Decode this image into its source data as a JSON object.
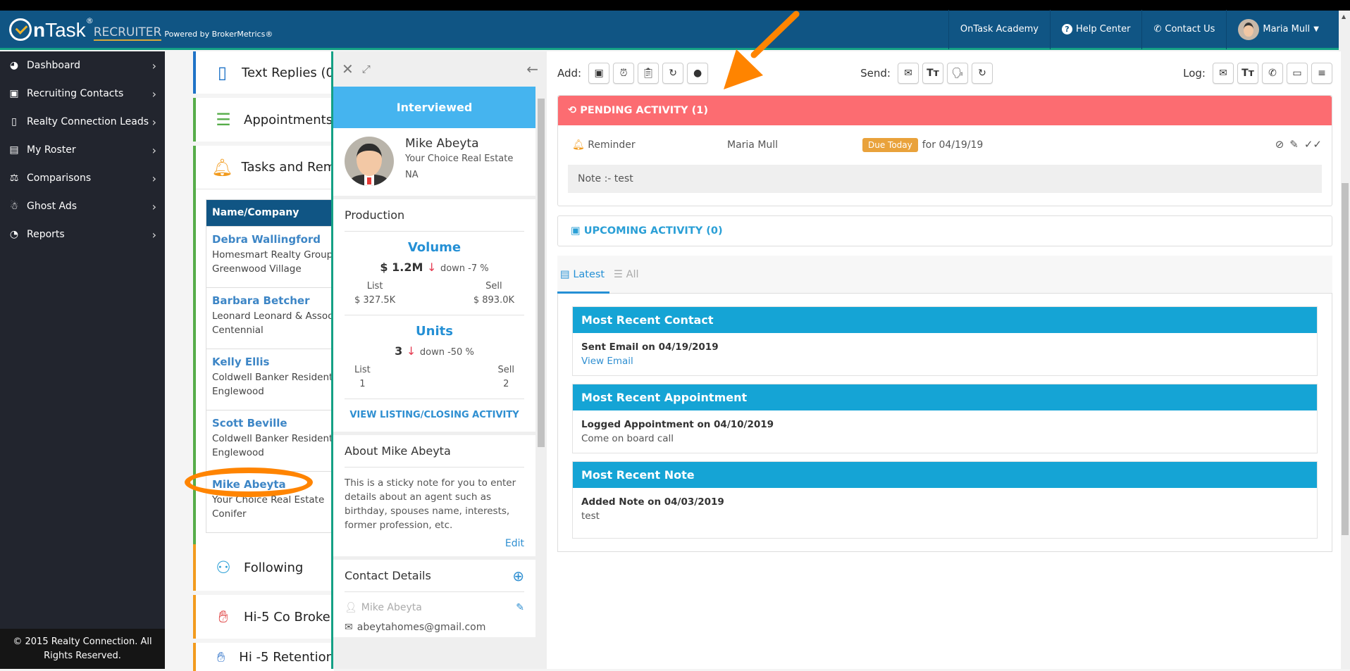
{
  "header": {
    "logo_on": "On",
    "logo_task": "Task",
    "logo_reg": "®",
    "logo_recruiter": "RECRUITER",
    "logo_powered": "Powered by BrokerMetrics®",
    "nav": [
      {
        "label": "OnTask Academy",
        "icon": ""
      },
      {
        "label": "Help Center",
        "icon": "question-circle"
      },
      {
        "label": "Contact Us",
        "icon": "phone"
      }
    ],
    "user": {
      "name": "Maria Mull",
      "icon": "chevron-down"
    }
  },
  "sidebar": {
    "items": [
      {
        "label": "Dashboard",
        "icon": "dashboard-gauge"
      },
      {
        "label": "Recruiting Contacts",
        "icon": "contact-card"
      },
      {
        "label": "Realty Connection Leads",
        "icon": "door"
      },
      {
        "label": "My Roster",
        "icon": "folder-network"
      },
      {
        "label": "Comparisons",
        "icon": "seesaw"
      },
      {
        "label": "Ghost Ads",
        "icon": "ghost"
      },
      {
        "label": "Reports",
        "icon": "pie-chart"
      }
    ],
    "footer": "© 2015 Realty Connection. All Rights Reserved."
  },
  "widgets": {
    "text_replies": "Text Replies (0",
    "appointments": "Appointments",
    "tasks": "Tasks and Rem",
    "table_header": "Name/Company",
    "rows": [
      {
        "name": "Debra Wallingford",
        "company": "Homesmart Realty Group",
        "city": "Greenwood Village"
      },
      {
        "name": "Barbara Betcher",
        "company": "Leonard Leonard & Assoc",
        "city": "Centennial"
      },
      {
        "name": "Kelly Ellis",
        "company": "Coldwell Banker Resident",
        "city": "Englewood"
      },
      {
        "name": "Scott Beville",
        "company": "Coldwell Banker Resident",
        "city": "Englewood"
      },
      {
        "name": "Mike Abeyta",
        "company": "Your Choice Real Estate",
        "city": "Conifer"
      }
    ],
    "following": "Following",
    "hi5_cobroke": "Hi-5 Co Broke",
    "hi5_retention": "Hi -5 Retention"
  },
  "profile": {
    "status": "Interviewed",
    "name": "Mike Abeyta",
    "company": "Your Choice Real Estate",
    "location": "NA",
    "production_title": "Production",
    "volume": {
      "title": "Volume",
      "value": "$ 1.2M",
      "trend": "down -7 %",
      "list_label": "List",
      "list_value": "$ 327.5K",
      "sell_label": "Sell",
      "sell_value": "$ 893.0K"
    },
    "units": {
      "title": "Units",
      "value": "3",
      "trend": "down -50 %",
      "list_label": "List",
      "list_value": "1",
      "sell_label": "Sell",
      "sell_value": "2"
    },
    "view_activity": "VIEW LISTING/CLOSING ACTIVITY",
    "about_title": "About Mike Abeyta",
    "about_text": "This is a sticky note for you to enter details about an agent such as birthday, spouses name, interests, former profession, etc.",
    "edit_label": "Edit",
    "contact_title": "Contact Details",
    "contact_name": "Mike Abeyta",
    "contact_email": "abeytahomes@gmail.com"
  },
  "toolbar": {
    "add_label": "Add:",
    "add_icons": [
      "calendar",
      "alarm-clock",
      "clipboard",
      "retry-circle",
      "record"
    ],
    "send_label": "Send:",
    "send_icons": [
      "envelope",
      "text-size",
      "voice",
      "retry-circle"
    ],
    "log_label": "Log:",
    "log_icons": [
      "envelope",
      "text-size",
      "phone",
      "calendar",
      "notes"
    ]
  },
  "pending": {
    "title": "PENDING ACTIVITY (1)",
    "type": "Reminder",
    "owner": "Maria Mull",
    "badge": "Due Today",
    "due": "for 04/19/19",
    "note": "Note :- test"
  },
  "upcoming": {
    "title": "UPCOMING ACTIVITY (0)"
  },
  "tabs": {
    "latest": "Latest",
    "all": "All"
  },
  "recent": [
    {
      "title": "Most Recent Contact",
      "line1": "Sent Email on 04/19/2019",
      "line2": "View Email"
    },
    {
      "title": "Most Recent Appointment",
      "line1": "Logged Appointment on 04/10/2019",
      "line2": "Come on board call"
    },
    {
      "title": "Most Recent Note",
      "line1": "Added Note on 04/03/2019",
      "line2": "test"
    }
  ],
  "colors": {
    "header": "#105584",
    "accent_teal": "#14a085",
    "pending": "#fc6c71",
    "recent_header": "#15a4d5",
    "status": "#45b4ef",
    "annotation": "#ff8400"
  }
}
